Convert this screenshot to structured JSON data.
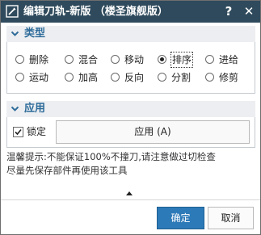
{
  "window": {
    "title": "编辑刀轨-新版 （楼圣旗舰版）",
    "help_label": "?",
    "close_label": "✕",
    "titlebar_color": "#2f4a5c"
  },
  "type_section": {
    "title": "类型",
    "accent": "#2d6b9a",
    "options": [
      {
        "label": "删除",
        "selected": false
      },
      {
        "label": "混合",
        "selected": false
      },
      {
        "label": "移动",
        "selected": false
      },
      {
        "label": "排序",
        "selected": true
      },
      {
        "label": "进给",
        "selected": false
      },
      {
        "label": "运动",
        "selected": false
      },
      {
        "label": "加高",
        "selected": false
      },
      {
        "label": "反向",
        "selected": false
      },
      {
        "label": "分割",
        "selected": false
      },
      {
        "label": "修剪",
        "selected": false
      }
    ]
  },
  "apply_section": {
    "title": "应用",
    "lock_label": "锁定",
    "lock_checked": true,
    "apply_button": "应用 (A)"
  },
  "tips": {
    "line1": "温馨提示:不能保证100%不撞刀,请注意做过切检查",
    "line2": "尽量先保存部件再使用该工具"
  },
  "footer": {
    "ok_label": "确定",
    "cancel_label": "取消",
    "ok_color": "#2d7ab8"
  }
}
